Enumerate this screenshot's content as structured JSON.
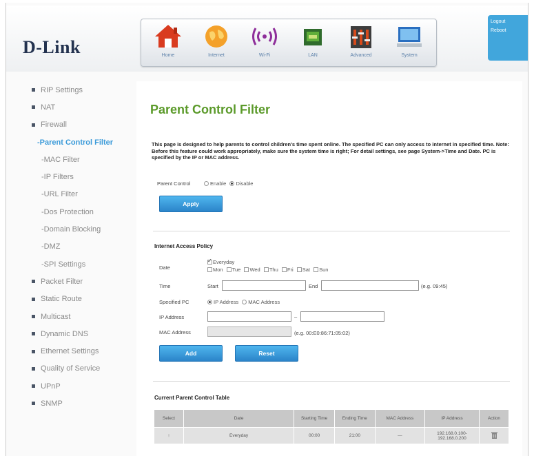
{
  "header": {
    "logo": "D-Link",
    "nav": [
      {
        "label": "Home",
        "icon": "home-icon"
      },
      {
        "label": "Internet",
        "icon": "internet-icon"
      },
      {
        "label": "Wi-Fi",
        "icon": "wifi-icon"
      },
      {
        "label": "LAN",
        "icon": "lan-icon"
      },
      {
        "label": "Advanced",
        "icon": "advanced-icon"
      },
      {
        "label": "System",
        "icon": "system-icon"
      }
    ],
    "user": {
      "logout": "Logout",
      "reboot": "Reboot"
    }
  },
  "sidebar": {
    "items": [
      {
        "label": "RIP Settings"
      },
      {
        "label": "NAT"
      },
      {
        "label": "Firewall"
      },
      {
        "label": "-Parent Control Filter"
      },
      {
        "label": "-MAC Filter"
      },
      {
        "label": "-IP Filters"
      },
      {
        "label": "-URL Filter"
      },
      {
        "label": "-Dos Protection"
      },
      {
        "label": "-Domain Blocking"
      },
      {
        "label": "-DMZ"
      },
      {
        "label": "-SPI Settings"
      },
      {
        "label": "Packet Filter"
      },
      {
        "label": "Static Route"
      },
      {
        "label": "Multicast"
      },
      {
        "label": "Dynamic DNS"
      },
      {
        "label": "Ethernet Settings"
      },
      {
        "label": "Quality of Service"
      },
      {
        "label": "UPnP"
      },
      {
        "label": "SNMP"
      }
    ]
  },
  "main": {
    "title": "Parent Control Filter",
    "description": "This page is designed to help parents to control children's time spent online. The specified PC can only access to internet in specified time. Note: Before this feature could work appropriately, make sure the system time is right; For detail settings, see page System->Time and Date. PC is specified by the IP or MAC address.",
    "parent_control": {
      "label": "Parent Control",
      "enable": "Enable",
      "disable": "Disable"
    },
    "apply_button": "Apply",
    "policy": {
      "title": "Internet Access Policy",
      "date_label": "Date",
      "everyday": "Everyday",
      "days": [
        "Mon",
        "Tue",
        "Wed",
        "Thu",
        "Fri",
        "Sat",
        "Sun"
      ],
      "time_label": "Time",
      "start_label": "Start",
      "end_label": "End",
      "time_hint": "(e.g. 09:45)",
      "specified_pc_label": "Specified PC",
      "ip_option": "IP Address",
      "mac_option": "MAC Address",
      "ip_label": "IP Address",
      "ip_dash": "–",
      "mac_label": "MAC Address",
      "mac_hint": "(e.g. 00:E0:86:71:05:02)"
    },
    "add_button": "Add",
    "reset_button": "Reset",
    "table": {
      "title": "Current Parent Control Table",
      "headers": [
        "Select",
        "Date",
        "Starting Time",
        "Ending Time",
        "MAC Address",
        "IP Address",
        "Action"
      ],
      "rows": [
        {
          "select": "↑",
          "date": "Everyday",
          "start": "00:00",
          "end": "21:00",
          "mac": "—",
          "ip": "192.168.0.100-192.168.0.200",
          "action_icon": "trash-icon"
        }
      ]
    }
  },
  "colors": {
    "accent": "#41a6dc",
    "title_green": "#5b9a2a",
    "button_blue": "#2b84c9"
  }
}
